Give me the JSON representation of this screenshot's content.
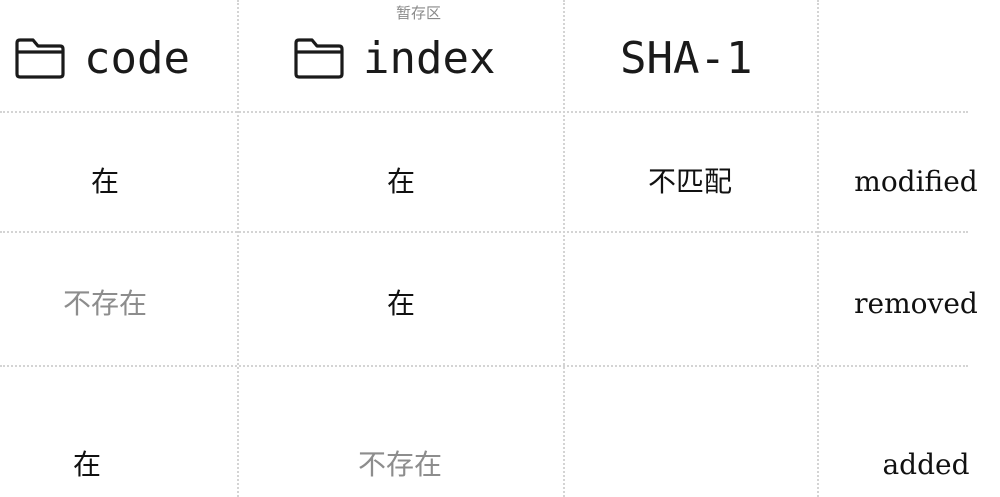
{
  "caption": "暂存区",
  "headers": {
    "code": {
      "label": "code",
      "icon": "folder-icon"
    },
    "index": {
      "label": "index",
      "icon": "folder-icon"
    },
    "sha": {
      "label": "SHA-1"
    }
  },
  "rows": [
    {
      "code": "在",
      "index": "在",
      "sha": "不匹配",
      "status": "modified"
    },
    {
      "code": "不存在",
      "index": "在",
      "sha": "",
      "status": "removed"
    },
    {
      "code": "在",
      "index": "不存在",
      "sha": "",
      "status": "added"
    }
  ],
  "colors": {
    "text": "#111111",
    "muted": "#8d8d8d",
    "grid": "#d4d4d4"
  }
}
